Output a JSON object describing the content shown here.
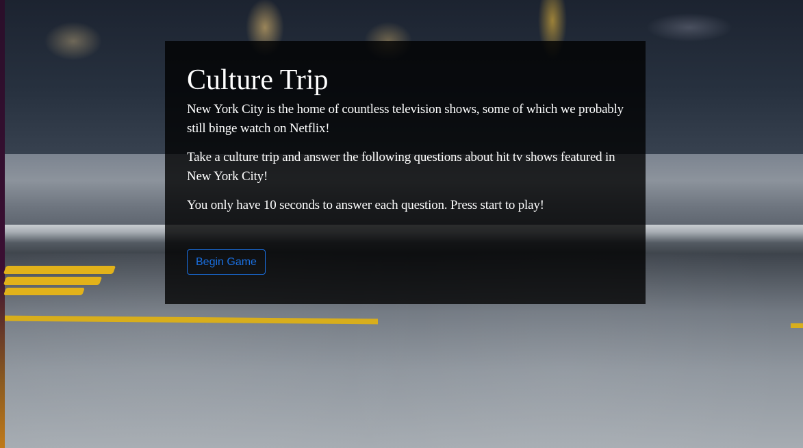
{
  "intro": {
    "title": "Culture Trip",
    "paragraphs": [
      "New York City is the home of countless television shows, some of which we probably still binge watch on Netflix!",
      "Take a culture trip and answer the following questions about hit tv shows featured in New York City!",
      "You only have 10 seconds to answer each question. Press start to play!"
    ],
    "begin_button_label": "Begin Game"
  },
  "colors": {
    "card_background": "#000000",
    "button_accent": "#1a6fe0",
    "text": "#ffffff"
  }
}
